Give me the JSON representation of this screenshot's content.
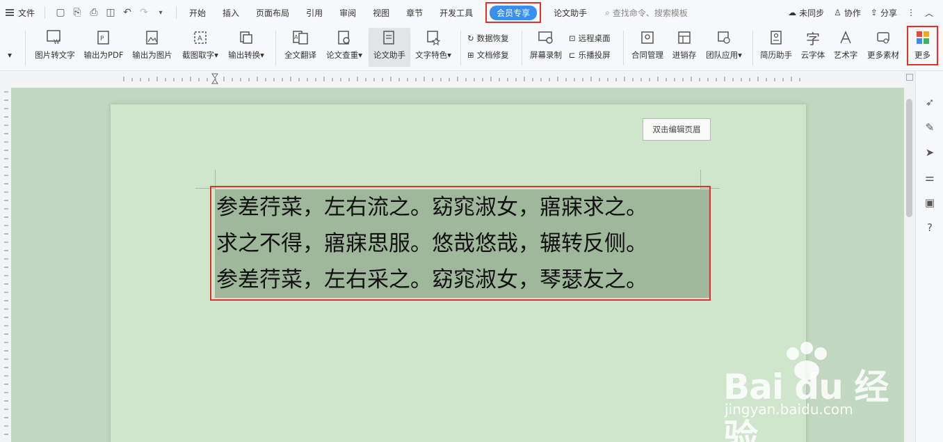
{
  "menubar": {
    "file_label": "文件",
    "tabs": [
      "开始",
      "插入",
      "页面布局",
      "引用",
      "审阅",
      "视图",
      "章节",
      "开发工具"
    ],
    "active_tab": "会员专享",
    "after_tab": "论文助手",
    "search_placeholder": "查找命令、搜索模板",
    "sync_label": "未同步",
    "collab_label": "协作",
    "share_label": "分享"
  },
  "ribbon": {
    "items": [
      "图片转文字",
      "输出为PDF",
      "输出为图片",
      "截图取字",
      "输出转换",
      "全文翻译",
      "论文查重",
      "论文助手",
      "文字特色"
    ],
    "small_items": [
      "数据恢复",
      "文档修复",
      "远程桌面",
      "乐播投屏"
    ],
    "items2": [
      "屏幕录制",
      "合同管理",
      "进销存",
      "团队应用",
      "简历助手",
      "云字体",
      "艺术字",
      "更多素材",
      "更多"
    ]
  },
  "document": {
    "header_tip": "双击编辑页眉",
    "lines": [
      "参差荇菜，左右流之。窈窕淑女，寤寐求之。",
      "求之不得，寤寐思服。悠哉悠哉，辗转反侧。",
      "参差荇菜，左右采之。窈窕淑女，琴瑟友之。"
    ]
  },
  "watermark": {
    "brand": "Bai du 经验",
    "url": "jingyan.baidu.com"
  },
  "colors": {
    "accent": "#3b8ef0",
    "highlight_frame": "#e0302a",
    "page_bg": "#cfe6cc",
    "selection": "#9fb79b"
  }
}
